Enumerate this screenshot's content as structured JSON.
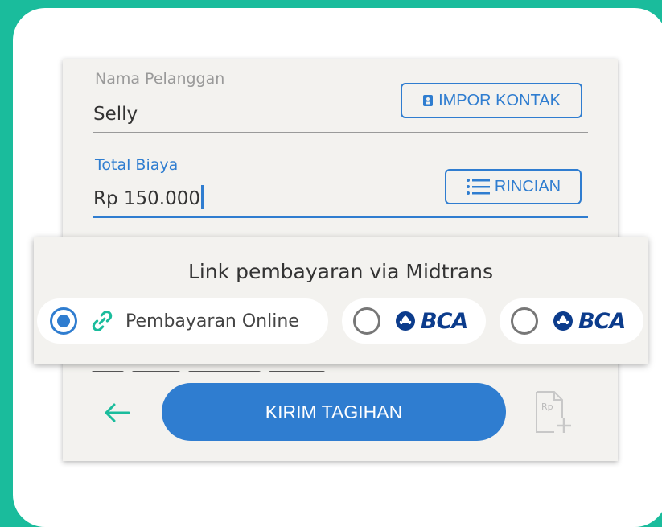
{
  "form": {
    "customer": {
      "label": "Nama Pelanggan",
      "value": "Selly",
      "import_button": "IMPOR KONTAK"
    },
    "total": {
      "label": "Total Biaya",
      "value": "Rp 150.000",
      "details_button": "RINCIAN"
    }
  },
  "payment_popup": {
    "title": "Link pembayaran via Midtrans",
    "options": [
      {
        "label": "Pembayaran Online",
        "selected": true
      },
      {
        "label": "BCA",
        "selected": false
      },
      {
        "label": "BCA",
        "selected": false
      }
    ]
  },
  "footer": {
    "send_button": "KIRIM TAGIHAN",
    "invoice_icon_text": "Rp"
  },
  "colors": {
    "accent": "#2f7dd0",
    "background": "#1abc9c",
    "card": "#f3f2ef",
    "back_arrow": "#1abc9c",
    "bca_brand": "#0c3c8c"
  },
  "icons": {
    "back": "arrow-left-icon",
    "contact": "contact-book-icon",
    "list": "list-icon",
    "link": "link-icon",
    "invoice": "invoice-add-icon"
  }
}
